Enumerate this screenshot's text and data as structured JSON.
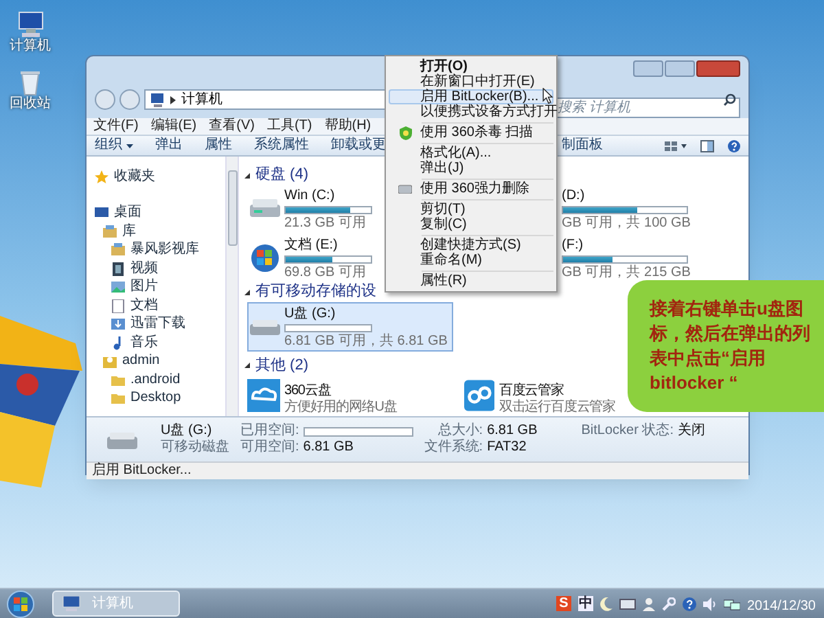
{
  "desktop_icons": [
    {
      "label": "计算机",
      "kind": "computer"
    },
    {
      "label": "回收站",
      "kind": "recycle"
    }
  ],
  "window": {
    "address": [
      "计算机"
    ],
    "search": {
      "placeholder": "搜索 计算机"
    },
    "menu_bar": [
      "文件(F)",
      "编辑(E)",
      "查看(V)",
      "工具(T)",
      "帮助(H)"
    ],
    "toolbar": [
      {
        "label": "组织",
        "dropdown": true
      },
      {
        "label": "弹出",
        "dropdown": false
      },
      {
        "label": "属性",
        "dropdown": false
      },
      {
        "label": "系统属性",
        "dropdown": false
      },
      {
        "label": "卸载或更",
        "dropdown": false
      }
    ],
    "toolbar_right": "制面板",
    "nav": [
      {
        "label": "收藏夹",
        "kind": "star"
      },
      {
        "label": "桌面",
        "kind": "desktop",
        "children": [
          {
            "label": "库",
            "kind": "library",
            "children": [
              {
                "label": "暴风影视库",
                "kind": "library"
              },
              {
                "label": "视频",
                "kind": "video"
              },
              {
                "label": "图片",
                "kind": "picture"
              },
              {
                "label": "文档",
                "kind": "document"
              },
              {
                "label": "迅雷下载",
                "kind": "download"
              },
              {
                "label": "音乐",
                "kind": "music"
              }
            ]
          },
          {
            "label": "admin",
            "kind": "user",
            "children": [
              {
                "label": ".android",
                "kind": "folder"
              },
              {
                "label": "Desktop",
                "kind": "folder"
              }
            ]
          }
        ]
      }
    ],
    "sections": [
      {
        "title": "硬盘 (4)",
        "kind": "drives",
        "items": [
          {
            "name": "Win (C:)",
            "free": "21.3 GB 可用",
            "level": 0.75,
            "kind": "disk",
            "selected": false
          },
          {
            "name": "(D:)",
            "free": "GB 可用，共 100 GB",
            "level": 0.6,
            "kind": "partial",
            "selected": false
          },
          {
            "name": "文档 (E:)",
            "free": "69.8 GB 可用",
            "level": 0.55,
            "kind": "system",
            "selected": false
          },
          {
            "name": "(F:)",
            "free": "GB 可用，共 215 GB",
            "level": 0.4,
            "kind": "partial",
            "selected": false
          }
        ]
      },
      {
        "title": "有可移动存储的设",
        "kind": "drives",
        "items": [
          {
            "name": "U盘 (G:)",
            "free": "6.81 GB 可用，共 6.81 GB",
            "level": 0.0,
            "kind": "usb",
            "selected": true
          }
        ]
      },
      {
        "title": "其他 (2)",
        "kind": "apps",
        "items": [
          {
            "name": "360云盘",
            "desc": "方便好用的网络U盘",
            "kind": "cloud"
          },
          {
            "name": "百度云管家",
            "desc": "双击运行百度云管家",
            "kind": "loop"
          }
        ]
      }
    ],
    "details": {
      "name": "U盘 (G:)",
      "type": "可移动磁盘",
      "used_label": "已用空间:",
      "used_bar": {
        "level": 0.0
      },
      "free_label": "可用空间:",
      "free": "6.81 GB",
      "total_label": "总大小:",
      "total": "6.81 GB",
      "fs_label": "文件系统:",
      "fs": "FAT32",
      "bitlocker_label": "BitLocker 状态:",
      "bitlocker": "关闭"
    },
    "status_bar": "启用 BitLocker..."
  },
  "context_menu": [
    {
      "kind": "item",
      "label": "打开(O)",
      "default": true,
      "selected": false
    },
    {
      "kind": "item",
      "label": "在新窗口中打开(E)",
      "default": false,
      "selected": false
    },
    {
      "kind": "item",
      "label": "启用 BitLocker(B)...",
      "default": false,
      "selected": true
    },
    {
      "kind": "item",
      "label": "以便携式设备方式打开",
      "default": false,
      "selected": false
    },
    {
      "kind": "separator"
    },
    {
      "kind": "shield",
      "label": "使用 360杀毒 扫描",
      "default": false,
      "selected": false
    },
    {
      "kind": "separator"
    },
    {
      "kind": "item",
      "label": "格式化(A)...",
      "default": false,
      "selected": false
    },
    {
      "kind": "item",
      "label": "弹出(J)",
      "default": false,
      "selected": false
    },
    {
      "kind": "separator"
    },
    {
      "kind": "eraser",
      "label": "使用 360强力删除",
      "default": false,
      "selected": false
    },
    {
      "kind": "separator"
    },
    {
      "kind": "item",
      "label": "剪切(T)",
      "default": false,
      "selected": false
    },
    {
      "kind": "item",
      "label": "复制(C)",
      "default": false,
      "selected": false
    },
    {
      "kind": "separator"
    },
    {
      "kind": "item",
      "label": "创建快捷方式(S)",
      "default": false,
      "selected": false
    },
    {
      "kind": "item",
      "label": "重命名(M)",
      "default": false,
      "selected": false
    },
    {
      "kind": "separator"
    },
    {
      "kind": "item",
      "label": "属性(R)",
      "default": false,
      "selected": false
    }
  ],
  "callout": "接着右键单击u盘图标，然后在弹出的列表中点击“启用bitlocker “",
  "taskbar": {
    "tasks": [
      {
        "label": "计算机",
        "selected": true
      }
    ],
    "tray": [
      "S",
      "中"
    ],
    "date": "2014/12/30"
  }
}
